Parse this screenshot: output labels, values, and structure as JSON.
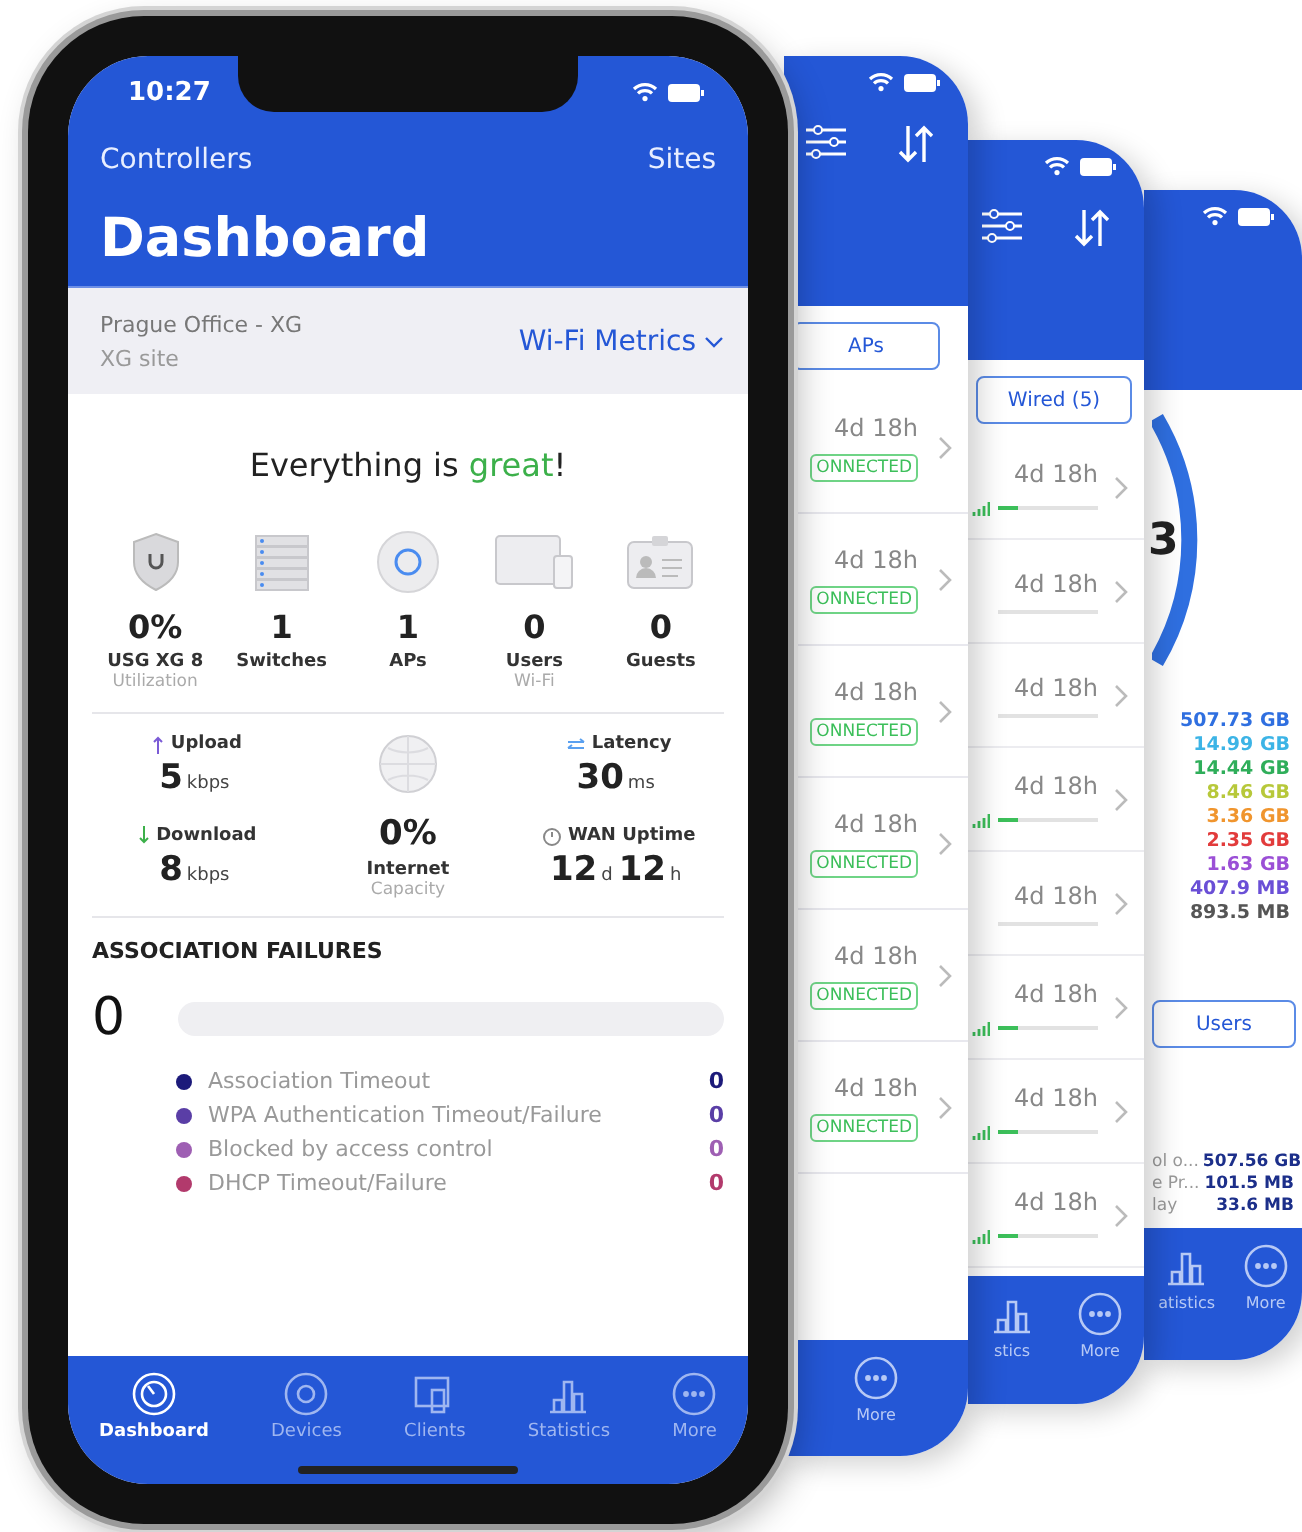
{
  "main_phone": {
    "status_bar": {
      "time": "10:27"
    },
    "nav": {
      "left": "Controllers",
      "right": "Sites"
    },
    "title": "Dashboard",
    "site": {
      "name": "Prague Office - XG",
      "subtitle": "XG site",
      "metrics_menu": "Wi-Fi Metrics"
    },
    "headline": {
      "prefix": "Everything is ",
      "highlight": "great",
      "suffix": "!"
    },
    "devices": [
      {
        "kind": "gateway",
        "value": "0%",
        "label": "USG XG 8",
        "sub": "Utilization"
      },
      {
        "kind": "switch",
        "value": "1",
        "label": "Switches"
      },
      {
        "kind": "ap",
        "value": "1",
        "label": "APs"
      },
      {
        "kind": "users",
        "value": "0",
        "label": "Users",
        "sub": "Wi-Fi"
      },
      {
        "kind": "guests",
        "value": "0",
        "label": "Guests"
      }
    ],
    "stats": {
      "upload": {
        "label": "Upload",
        "value": "5",
        "unit": "kbps"
      },
      "download": {
        "label": "Download",
        "value": "8",
        "unit": "kbps"
      },
      "latency": {
        "label": "Latency",
        "value": "30",
        "unit": "ms"
      },
      "uptime": {
        "label": "WAN Uptime",
        "parts": [
          {
            "value": "12",
            "unit": "d"
          },
          {
            "value": "12",
            "unit": "h"
          }
        ]
      },
      "internet": {
        "value": "0%",
        "label": "Internet",
        "sub": "Capacity"
      }
    },
    "association_failures": {
      "title": "ASSOCIATION FAILURES",
      "count": "0",
      "level": 0,
      "items": [
        {
          "label": "Association Timeout",
          "count": "0",
          "color": "#1c1a7a"
        },
        {
          "label": "WPA Authentication Timeout/Failure",
          "count": "0",
          "color": "#5a3ea6"
        },
        {
          "label": "Blocked by access control",
          "count": "0",
          "color": "#9e5fb3"
        },
        {
          "label": "DHCP Timeout/Failure",
          "count": "0",
          "color": "#b23a6c"
        }
      ]
    },
    "tabs": [
      {
        "kind": "dashboard",
        "label": "Dashboard",
        "selected": true
      },
      {
        "kind": "devices",
        "label": "Devices",
        "selected": false
      },
      {
        "kind": "clients",
        "label": "Clients",
        "selected": false
      },
      {
        "kind": "statistics",
        "label": "Statistics",
        "selected": false
      },
      {
        "kind": "more",
        "label": "More",
        "selected": false
      }
    ]
  },
  "devices_phone": {
    "filter": "APs",
    "rows": [
      {
        "uptime": "4d 18h",
        "status": "ONNECTED"
      },
      {
        "uptime": "4d 18h",
        "status": "ONNECTED"
      },
      {
        "uptime": "4d 18h",
        "status": "ONNECTED"
      },
      {
        "uptime": "4d 18h",
        "status": "ONNECTED"
      },
      {
        "uptime": "4d 18h",
        "status": "ONNECTED"
      },
      {
        "uptime": "4d 18h",
        "status": "ONNECTED"
      }
    ],
    "tab": "More"
  },
  "clients_phone": {
    "filter": "Wired (5)",
    "rows": [
      {
        "uptime": "4d 18h",
        "signal": true
      },
      {
        "uptime": "4d 18h",
        "signal": false
      },
      {
        "uptime": "4d 18h",
        "signal": false
      },
      {
        "uptime": "4d 18h",
        "signal": true
      },
      {
        "uptime": "4d 18h",
        "signal": false
      },
      {
        "uptime": "4d 18h",
        "signal": true
      },
      {
        "uptime": "4d 18h",
        "signal": true
      },
      {
        "uptime": "4d 18h",
        "signal": true
      }
    ],
    "tabs": [
      "stics",
      "More"
    ]
  },
  "statistics_phone": {
    "donut_label": "3",
    "amounts": [
      {
        "value": "507.73 GB",
        "color": "#2f6fe0"
      },
      {
        "value": "14.99 GB",
        "color": "#3cb4e6"
      },
      {
        "value": "14.44 GB",
        "color": "#2fae5a"
      },
      {
        "value": "8.46 GB",
        "color": "#b7c83a"
      },
      {
        "value": "3.36 GB",
        "color": "#f0952e"
      },
      {
        "value": "2.35 GB",
        "color": "#e23b3b"
      },
      {
        "value": "1.63 GB",
        "color": "#9b4fd6"
      },
      {
        "value": "407.9 MB",
        "color": "#6a4fd6"
      },
      {
        "value": "893.5 MB",
        "color": "#555555"
      }
    ],
    "filter": "Users",
    "rows": [
      {
        "name": "ol o...",
        "value": "507.56 GB"
      },
      {
        "name": "e Pr...",
        "value": "101.5 MB"
      },
      {
        "name": "lay",
        "value": "33.6 MB"
      }
    ],
    "tabs": [
      "atistics",
      "More"
    ]
  }
}
